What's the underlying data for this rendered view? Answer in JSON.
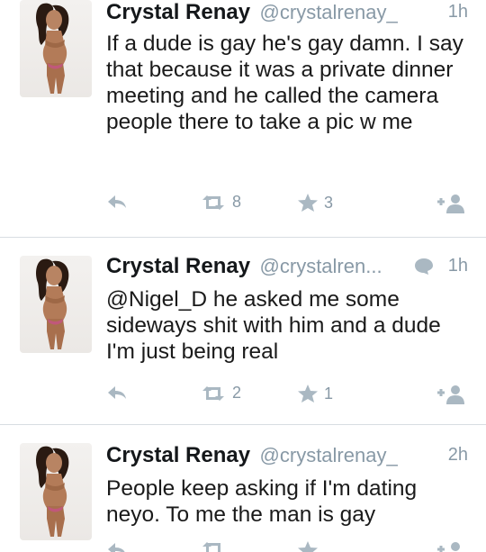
{
  "colors": {
    "meta": "#8899a6",
    "icon": "#aab8c2",
    "divider": "#d8dde2",
    "text": "#1a1a1a"
  },
  "tweets": [
    {
      "name": "Crystal Renay",
      "handle": "@crystalrenay_",
      "time": "1h",
      "text": "If a dude is gay he's gay damn. I say that because it was a private dinner meeting and he called the camera people there to take a pic w me",
      "retweets": "8",
      "favorites": "3",
      "has_conversation_icon": false
    },
    {
      "name": "Crystal Renay",
      "handle": "@crystalren...",
      "time": "1h",
      "text": "@Nigel_D he asked me some sideways shit with him and a dude I'm just being real",
      "retweets": "2",
      "favorites": "1",
      "has_conversation_icon": true
    },
    {
      "name": "Crystal Renay",
      "handle": "@crystalrenay_",
      "time": "2h",
      "text": "People keep asking if I'm dating neyo. To me the man is gay",
      "retweets": "",
      "favorites": "",
      "has_conversation_icon": false
    }
  ],
  "icons": {
    "reply": "reply-icon",
    "retweet": "retweet-icon",
    "favorite": "star-icon",
    "follow": "add-user-icon",
    "conversation": "speech-bubble-icon"
  }
}
